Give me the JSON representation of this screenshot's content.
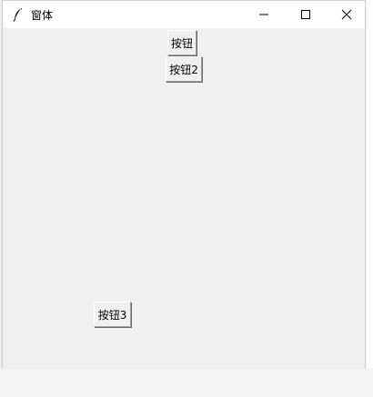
{
  "window": {
    "title": "窗体",
    "icon": "feather-icon"
  },
  "titlebar": {
    "minimize_icon": "minimize-icon",
    "maximize_icon": "maximize-icon",
    "close_icon": "close-icon"
  },
  "buttons": {
    "button1_label": "按钮",
    "button2_label": "按钮2",
    "button3_label": "按钮3"
  },
  "colors": {
    "titlebar_bg": "#ffffff",
    "client_bg": "#f0f0f0"
  }
}
